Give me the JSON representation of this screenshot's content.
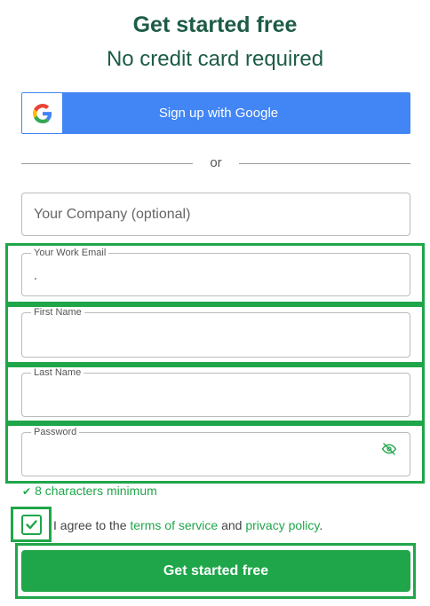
{
  "header": {
    "title": "Get started free",
    "subtitle": "No credit card required"
  },
  "google_button": {
    "label": "Sign up with Google",
    "icon": "google-g-icon",
    "color": "#4285f4"
  },
  "divider": {
    "label": "or"
  },
  "company_field": {
    "placeholder": "Your Company (optional)",
    "value": ""
  },
  "email_field": {
    "label": "Your Work Email",
    "value": "."
  },
  "first_name_field": {
    "label": "First Name",
    "value": ""
  },
  "last_name_field": {
    "label": "Last Name",
    "value": ""
  },
  "password_field": {
    "label": "Password",
    "value": "",
    "icon": "eye-slash-icon"
  },
  "password_hint": {
    "text": "8 characters minimum",
    "icon": "checkmark-icon"
  },
  "agreement": {
    "checked": true,
    "prefix": "I agree to the",
    "terms_link": "terms of service",
    "middle": "and",
    "privacy_link": "privacy policy",
    "suffix": "."
  },
  "submit_button": {
    "label": "Get started free",
    "color": "#1fa64a"
  },
  "colors": {
    "heading": "#1d5c45",
    "accent": "#1fa64a",
    "highlight": "#1fa64a"
  }
}
